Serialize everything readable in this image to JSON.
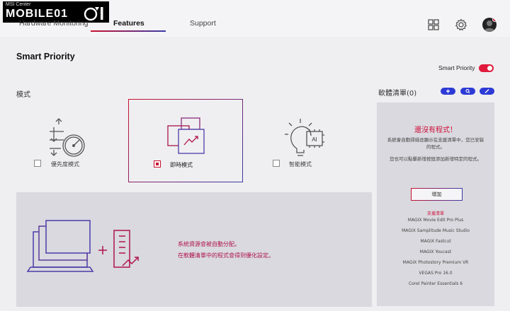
{
  "app": {
    "logo_small": "MSI Center",
    "logo_big": "MOBILE01"
  },
  "tabs": [
    {
      "label": "Hardware Monitoring"
    },
    {
      "label": "Features"
    },
    {
      "label": "Support"
    }
  ],
  "top_icons": [
    "grid-icon",
    "gear-icon",
    "avatar"
  ],
  "page": {
    "title": "Smart Priority",
    "toggle_label": "Smart Priority",
    "toggle_on": true,
    "mode_label": "模式"
  },
  "modes": [
    {
      "label": "優先度模式",
      "icon": "priority-gauge-icon",
      "checked": false
    },
    {
      "label": "即時模式",
      "icon": "realtime-windows-icon",
      "checked": true
    },
    {
      "label": "智能模式",
      "icon": "ai-bulb-icon",
      "checked": false
    }
  ],
  "description": {
    "line1": "系統資源會被自動分配。",
    "line2": "在軟體清單中的程式會得到優化設定。"
  },
  "software_list": {
    "label": "軟體清單",
    "count": "(0)",
    "buttons": [
      "add-icon",
      "search-icon",
      "edit-icon"
    ],
    "empty_title": "還沒有程式！",
    "empty_text1": "系統會自動掃描並顯示在支援清單中，您已安裝的程式。",
    "empty_text2": "您也可以點擊新增按鈕添加新增特定的程式。",
    "add_button": "增加",
    "supported_title": "支援清單",
    "supported": [
      "MAGIX Movie Edit Pro Plus",
      "MAGIX Samplitude Music Studio",
      "MAGIX Fastcut",
      "MAGIX Youcast",
      "MAGIX Photostory Premium VR",
      "VEGAS Pro 16.0",
      "Corel Painter Essentials 6"
    ]
  },
  "colors": {
    "accent_red": "#d0103a",
    "accent_blue": "#2d3bd6"
  }
}
